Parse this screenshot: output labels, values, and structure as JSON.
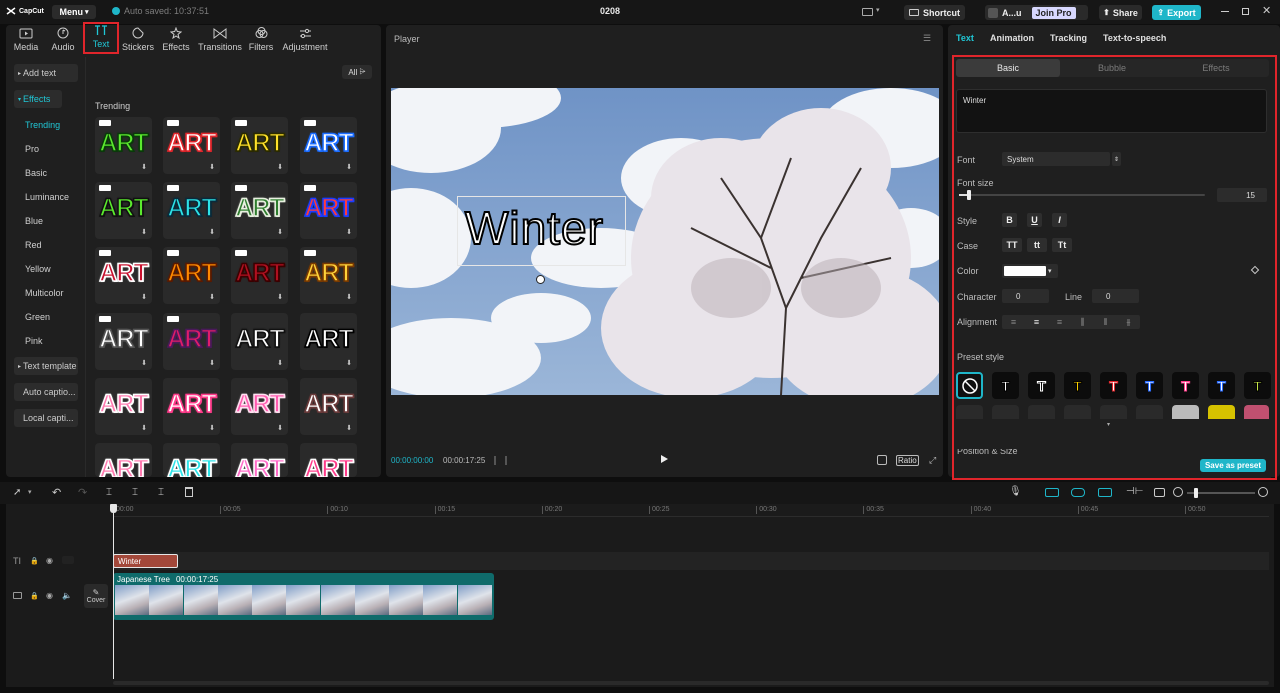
{
  "titlebar": {
    "logo": "CapCut",
    "menu": "Menu",
    "autosave": "Auto saved: 10:37:51",
    "project": "0208",
    "shortcut": "Shortcut",
    "account": "A...u",
    "join_pro": "Join Pro",
    "share": "Share",
    "export": "Export"
  },
  "left_tabs": [
    {
      "label": "Media",
      "icon": "media-icon"
    },
    {
      "label": "Audio",
      "icon": "audio-icon"
    },
    {
      "label": "Text",
      "icon": "text-icon"
    },
    {
      "label": "Stickers",
      "icon": "sticker-icon"
    },
    {
      "label": "Effects",
      "icon": "effects-icon"
    },
    {
      "label": "Transitions",
      "icon": "transitions-icon"
    },
    {
      "label": "Filters",
      "icon": "filters-icon"
    },
    {
      "label": "Adjustment",
      "icon": "adjustment-icon"
    }
  ],
  "sidebar": {
    "add_text": "Add text",
    "effects": "Effects",
    "items": [
      "Trending",
      "Pro",
      "Basic",
      "Luminance",
      "Blue",
      "Red",
      "Yellow",
      "Multicolor",
      "Green",
      "Pink"
    ],
    "text_template": "Text template",
    "auto_captions": "Auto captio...",
    "local_captions": "Local capti..."
  },
  "filter_all": "All",
  "trending_title": "Trending",
  "tiles": [
    {
      "text": "ART",
      "color": "#5bea2e",
      "stroke": "#0a3a0a"
    },
    {
      "text": "ART",
      "color": "#ffffff",
      "stroke": "#e0252b"
    },
    {
      "text": "ART",
      "color": "#ffe12a",
      "stroke": "#2b2b00"
    },
    {
      "text": "ART",
      "color": "#ffffff",
      "stroke": "#1a6cff"
    },
    {
      "text": "ART",
      "color": "#5bea2e",
      "stroke": "#111111"
    },
    {
      "text": "ART",
      "color": "#2de3e8",
      "stroke": "#0a2a3a"
    },
    {
      "text": "ART",
      "color": "#2e7d2e",
      "stroke": "#e8f0e0"
    },
    {
      "text": "ART",
      "color": "#ff3b3b",
      "stroke": "#1a3cff"
    },
    {
      "text": "ART",
      "color": "#c8102e",
      "stroke": "#ffffff"
    },
    {
      "text": "ART",
      "color": "#ff8a00",
      "stroke": "#5a1a00"
    },
    {
      "text": "ART",
      "color": "#b01020",
      "stroke": "#3a0000"
    },
    {
      "text": "ART",
      "color": "#ffd23a",
      "stroke": "#7a3a00"
    },
    {
      "text": "ART",
      "color": "#ffffff",
      "stroke": "#555555"
    },
    {
      "text": "ART",
      "color": "#e01c6a",
      "stroke": "#4a1a5a"
    },
    {
      "text": "ART",
      "color": "#ffffff",
      "stroke": "#111111"
    },
    {
      "text": "ART",
      "color": "#ffffff",
      "stroke": "#000000"
    },
    {
      "text": "ART",
      "color": "#ff7bb0",
      "stroke": "#ffffff"
    },
    {
      "text": "ART",
      "color": "#ffffff",
      "stroke": "#ff3b8a"
    },
    {
      "text": "ART",
      "color": "#ff5bb0",
      "stroke": "#ffe0f0"
    },
    {
      "text": "ART",
      "color": "#ffffff",
      "stroke": "#6a3a3a"
    },
    {
      "text": "ART",
      "color": "#ff7bb0",
      "stroke": "#ffffff"
    },
    {
      "text": "ART",
      "color": "#2de3e8",
      "stroke": "#ffffff"
    },
    {
      "text": "ART",
      "color": "#ff6bc8",
      "stroke": "#ffffff"
    },
    {
      "text": "ART",
      "color": "#ff3b8a",
      "stroke": "#ffffff"
    }
  ],
  "player": {
    "title": "Player",
    "overlay_text": "Winter",
    "current_time": "00:00:00:00",
    "total_time": "00:00:17:25",
    "ratio": "Ratio"
  },
  "right_tabs": [
    "Text",
    "Animation",
    "Tracking",
    "Text-to-speech"
  ],
  "sub_tabs": [
    "Basic",
    "Bubble",
    "Effects"
  ],
  "text_content": "Winter",
  "props": {
    "font_label": "Font",
    "font_value": "System",
    "font_size_label": "Font size",
    "font_size_value": "15",
    "font_size_fraction": 0.04,
    "style_label": "Style",
    "case_label": "Case",
    "case_options": [
      "TT",
      "tt",
      "Tt"
    ],
    "color_label": "Color",
    "color_value": "#ffffff",
    "character_label": "Character",
    "character_value": "0",
    "line_label": "Line",
    "line_value": "0",
    "alignment_label": "Alignment",
    "preset_label": "Preset style",
    "position_label": "Position & Size",
    "save_preset": "Save as preset"
  },
  "presets": [
    {
      "glyph": "T",
      "color": "#ffffff"
    },
    {
      "glyph": "T",
      "color": "#000000"
    },
    {
      "glyph": "T",
      "color": "#ffd400"
    },
    {
      "glyph": "T",
      "color": "#ffffff"
    },
    {
      "glyph": "T",
      "color": "#ffffff"
    },
    {
      "glyph": "T",
      "color": "#ffffff"
    },
    {
      "glyph": "T",
      "color": "#ffffff"
    },
    {
      "glyph": "T",
      "color": "#c8e84a"
    }
  ],
  "timeline": {
    "ruler": [
      "00:00",
      "00:05",
      "00:10",
      "00:15",
      "00:20",
      "00:25",
      "00:30",
      "00:35",
      "00:40",
      "00:45",
      "00:50"
    ],
    "text_clip": "Winter",
    "video_clip": "Japanese Tree",
    "video_clip_time": "00:00:17:25",
    "cover": "Cover"
  }
}
